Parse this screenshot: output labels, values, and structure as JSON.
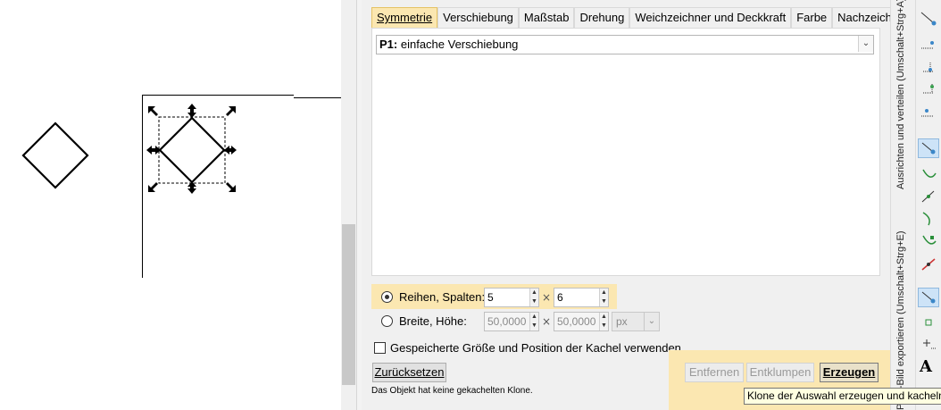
{
  "tabs": [
    {
      "label": "Symmetrie",
      "active": true
    },
    {
      "label": "Verschiebung",
      "active": false
    },
    {
      "label": "Maßstab",
      "active": false
    },
    {
      "label": "Drehung",
      "active": false
    },
    {
      "label": "Weichzeichner und Deckkraft",
      "active": false
    },
    {
      "label": "Farbe",
      "active": false
    },
    {
      "label": "Nachzeichnen",
      "active": false
    }
  ],
  "symmetry_select": {
    "prefix": "P1:",
    "value": "einfache Verschiebung"
  },
  "rows_cols": {
    "label": "Reihen, Spalten:",
    "rows": "5",
    "cols": "6",
    "selected": true
  },
  "width_height": {
    "label": "Breite, Höhe:",
    "width": "50,0000",
    "height": "50,0000",
    "unit": "px",
    "selected": false
  },
  "times_symbol": "×",
  "saved_size_checkbox": {
    "label": "Gespeicherte Größe und Position der Kachel verwenden",
    "checked": false
  },
  "buttons": {
    "reset": "Zurücksetzen",
    "remove": "Entfernen",
    "unclump": "Entklumpen",
    "create": "Erzeugen"
  },
  "status_text": "Das Objekt hat keine gekachelten Klone.",
  "tooltip": "Klone der Auswahl erzeugen und kacheln",
  "vertical_labels": {
    "align": "Ausrichten und verteilen (Umschalt+Strg+A)",
    "export": "PNG-Bild exportieren (Umschalt+Strg+E)"
  },
  "colors": {
    "highlight": "#fbe7b1",
    "accent_border": "#e5c365"
  }
}
